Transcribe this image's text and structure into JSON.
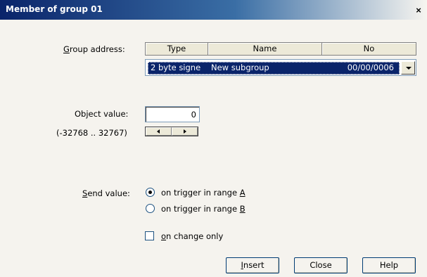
{
  "window": {
    "title": "Member of group 01",
    "close_glyph": "×"
  },
  "group_address": {
    "label_prefix": "",
    "label_accel": "G",
    "label_rest": "roup address:",
    "columns": [
      "Type",
      "Name",
      "No"
    ],
    "selected": {
      "type": "2 byte signe",
      "name": "New subgroup",
      "no": "00/00/0006"
    }
  },
  "object_value": {
    "label": "Object value:",
    "value": "0",
    "range": "(-32768 .. 32767)"
  },
  "send_value": {
    "label_accel": "S",
    "label_rest": "end value:",
    "options": [
      {
        "text": "on trigger in range ",
        "accel": "A",
        "checked": true
      },
      {
        "text": "on trigger in range ",
        "accel": "B",
        "checked": false
      }
    ],
    "on_change": {
      "accel": "o",
      "rest": "n change only",
      "checked": false
    }
  },
  "buttons": {
    "insert_accel": "I",
    "insert_rest": "nsert",
    "close": "Close",
    "help": "Help"
  }
}
